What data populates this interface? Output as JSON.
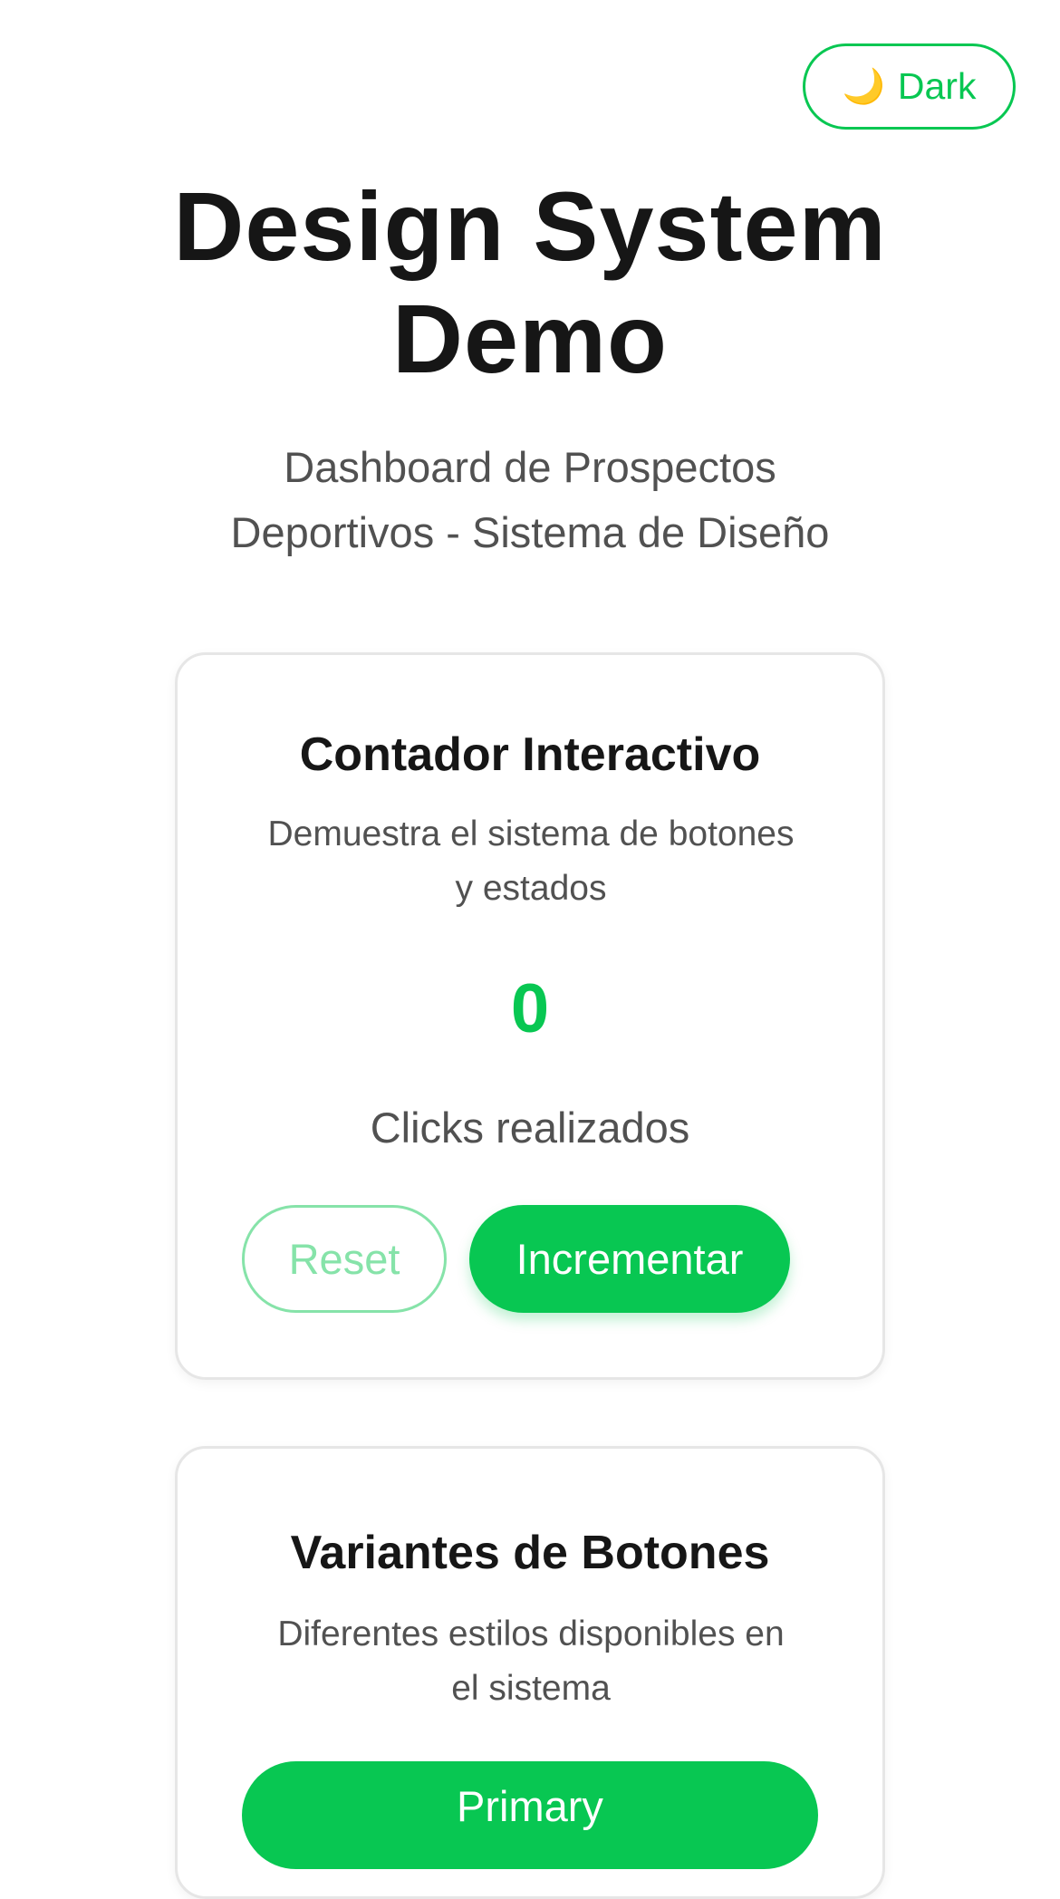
{
  "theme_toggle": {
    "icon": "moon-icon",
    "icon_glyph": "🌙",
    "label": "Dark"
  },
  "header": {
    "title_line1": "Design System",
    "title_line2": "Demo",
    "subtitle_line1": "Dashboard de Prospectos",
    "subtitle_line2": "Deportivos - Sistema de Diseño"
  },
  "counter_card": {
    "title": "Contador Interactivo",
    "description_line1": "Demuestra el sistema de botones",
    "description_line2": "y estados",
    "value": "0",
    "value_label": "Clicks realizados",
    "reset_label": "Reset",
    "increment_label": "Incrementar"
  },
  "variants_card": {
    "title": "Variantes de Botones",
    "description_line1": "Diferentes estilos disponibles en",
    "description_line2": "el sistema",
    "primary_label": "Primary"
  },
  "colors": {
    "accent": "#08c752",
    "accent_light": "#86e3a9",
    "text": "#161616",
    "muted_text": "#515151",
    "border": "#e6e6e6"
  }
}
